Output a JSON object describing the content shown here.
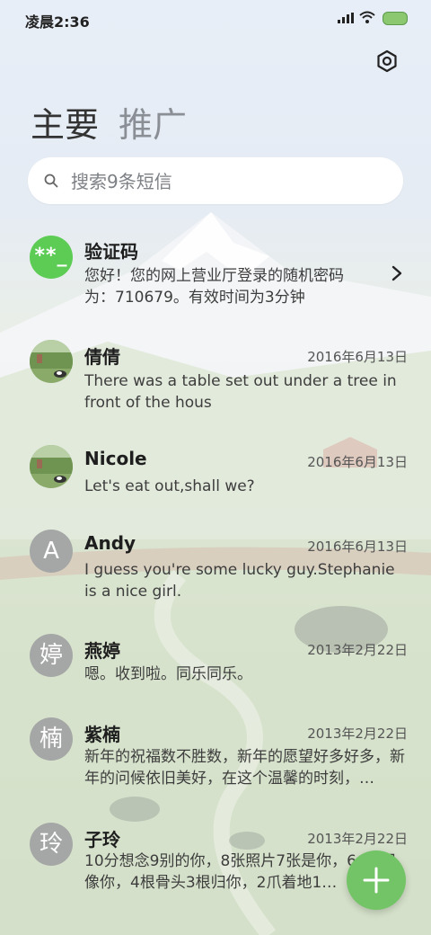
{
  "status": {
    "time": "凌晨2:36"
  },
  "tabs": {
    "main": "主要",
    "promo": "推广"
  },
  "search": {
    "placeholder": "搜索9条短信"
  },
  "conversations": [
    {
      "name": "验证码",
      "avatar": "**_",
      "date": "",
      "preview": "您好！您的网上营业厅登录的随机密码为：710679。有效时间为3分钟"
    },
    {
      "name": "倩倩",
      "avatar": "",
      "date": "2016年6月13日",
      "preview": "There was a table set out under a tree in front of the hous"
    },
    {
      "name": "Nicole",
      "avatar": "",
      "date": "2016年6月13日",
      "preview": "Let's eat out,shall we?"
    },
    {
      "name": "Andy",
      "avatar": "A",
      "date": "2016年6月13日",
      "preview": "I guess you're some lucky guy.Stephanie is a nice girl."
    },
    {
      "name": "燕婷",
      "avatar": "婷",
      "date": "2013年2月22日",
      "preview": "嗯。收到啦。同乐同乐。"
    },
    {
      "name": "紫楠",
      "avatar": "楠",
      "date": "2013年2月22日",
      "preview": "新年的祝福数不胜数，新年的愿望好多好多，新年的问候依旧美好，在这个温馨的时刻，…"
    },
    {
      "name": "子玲",
      "avatar": "玲",
      "date": "2013年2月22日",
      "preview": "10分想念9别的你，8张照片7张是你，6…5只像你，4根骨头3根归你，2爪着地1…"
    }
  ],
  "colors": {
    "accent": "#72c466",
    "code_avatar": "#5ccc55",
    "letter_avatar": "#a5a7a6"
  },
  "icons": {
    "settings": "settings-icon",
    "search": "search-icon",
    "fab": "plus-icon"
  }
}
